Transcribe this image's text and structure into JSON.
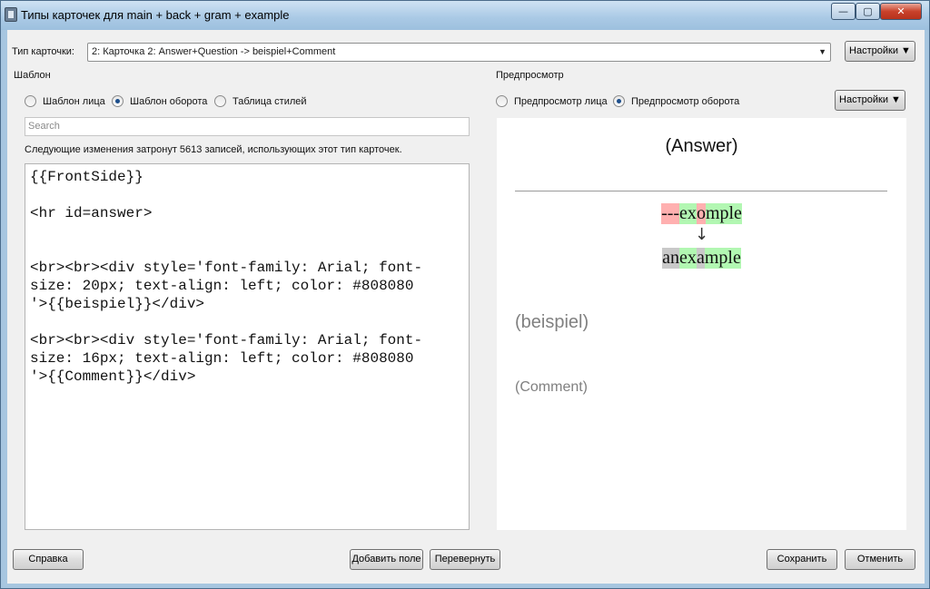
{
  "window": {
    "title": "Типы карточек для main + back + gram + example",
    "minimize": "—",
    "maximize": "▢",
    "close": "✕"
  },
  "card_type": {
    "label": "Тип карточки:",
    "value": "2: Карточка 2: Answer+Question -> beispiel+Comment",
    "arrow": "▼",
    "settings_button": "Настройки ▼"
  },
  "template": {
    "group_title": "Шаблон",
    "radios": [
      {
        "label": "Шаблон лица",
        "selected": false
      },
      {
        "label": "Шаблон оборота",
        "selected": true
      },
      {
        "label": "Таблица стилей",
        "selected": false
      }
    ],
    "search_placeholder": "Search",
    "notice": "Следующие изменения затронут 5613 записей, использующих этот тип карточек.",
    "code_lines": [
      "{{FrontSide}}",
      "",
      "<hr id=answer>",
      "",
      "",
      "<br><br><div style='font-family: Arial; font-",
      "size: 20px; text-align: left; color: #808080",
      "'>{{beispiel}}</div>",
      "",
      "<br><br><div style='font-family: Arial; font-",
      "size: 16px; text-align: left; color: #808080",
      "'>{{Comment}}</div>"
    ]
  },
  "preview": {
    "group_title": "Предпросмотр",
    "radios": [
      {
        "label": "Предпросмотр лица",
        "selected": false
      },
      {
        "label": "Предпросмотр оборота",
        "selected": true
      }
    ],
    "settings_button": "Настройки ▼",
    "answer": "(Answer)",
    "typed": {
      "bad1": "---",
      "good1": "ex",
      "bad2": "o",
      "good2": "mple"
    },
    "down_arrow": "↓",
    "expected": {
      "miss": "an ",
      "good1": "ex",
      "miss2": "a",
      "good2": "mple"
    },
    "beispiel": "(beispiel)",
    "comment": "(Comment)"
  },
  "footer": {
    "help": "Справка",
    "add_field": "Добавить поле",
    "flip": "Перевернуть",
    "save": "Сохранить",
    "cancel": "Отменить"
  },
  "colors": {
    "diff_bad": "#ffb0b0",
    "diff_good": "#b2f7b2",
    "diff_missing": "#c9c9c9",
    "field_gray": "#808080"
  }
}
